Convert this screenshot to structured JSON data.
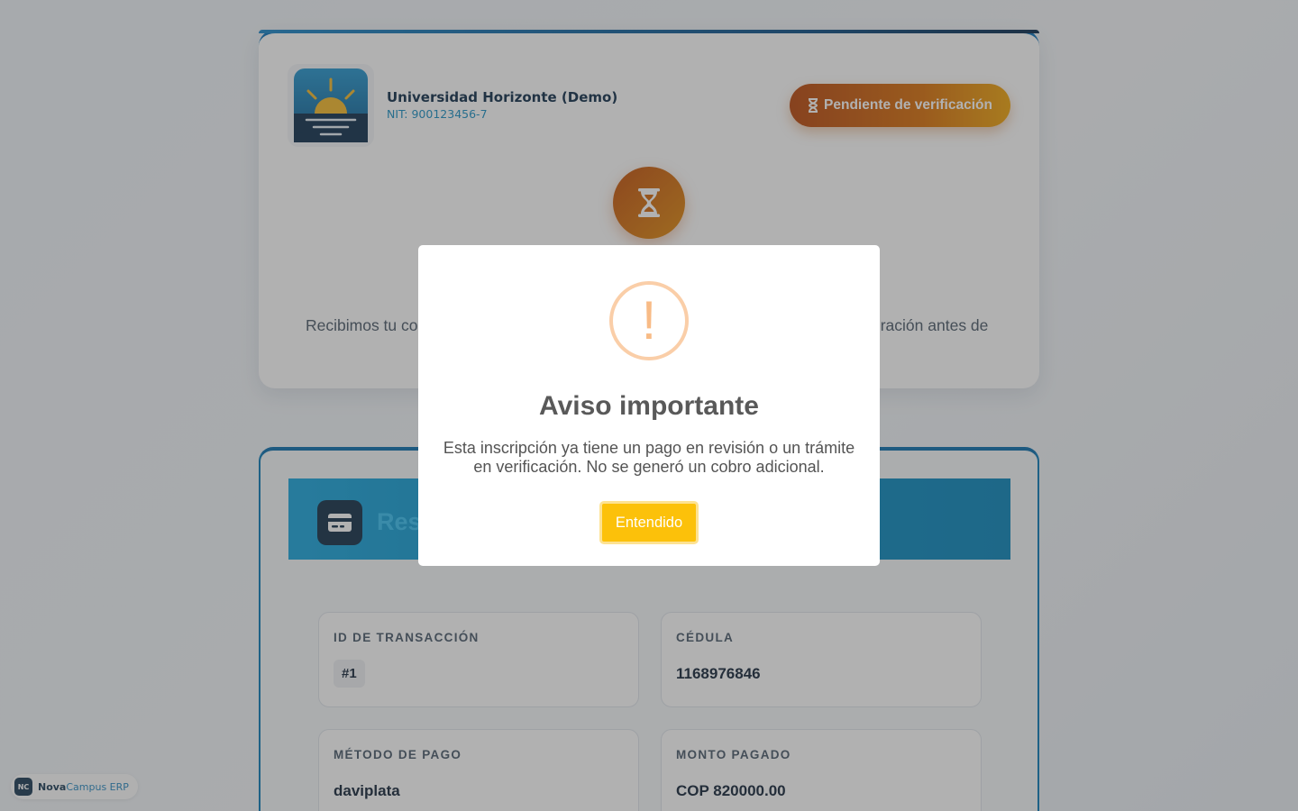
{
  "institution": {
    "name": "Universidad Horizonte (Demo)",
    "nit": "NIT: 900123456-7"
  },
  "status": {
    "label": "Pendiente de verificación",
    "icon": "hourglass-icon"
  },
  "hero": {
    "message_start": "Recibimos tu co",
    "message_end": "eración antes de"
  },
  "summary": {
    "title_partial": "Res",
    "fields": [
      {
        "label": "ID DE TRANSACCIÓN",
        "value": "#1"
      },
      {
        "label": "CÉDULA",
        "value": "1168976846"
      },
      {
        "label": "MÉTODO DE PAGO",
        "value": "daviplata"
      },
      {
        "label": "MONTO PAGADO",
        "value": "COP 820000.00"
      }
    ]
  },
  "brand": {
    "mark": "NC",
    "name_bold": "Nova",
    "name_rest": "Campus ERP"
  },
  "modal": {
    "icon_glyph": "!",
    "title": "Aviso importante",
    "text": "Esta inscripción ya tiene un pago en revisión o un trámite en verificación. No se generó un cobro adicional.",
    "confirm_label": "Entendido"
  },
  "colors": {
    "accent": "#0b72b9",
    "warning": "#f8bb86",
    "confirm": "#fcc10a",
    "status_gradient_start": "#b9470d",
    "status_gradient_end": "#f0a50d"
  }
}
